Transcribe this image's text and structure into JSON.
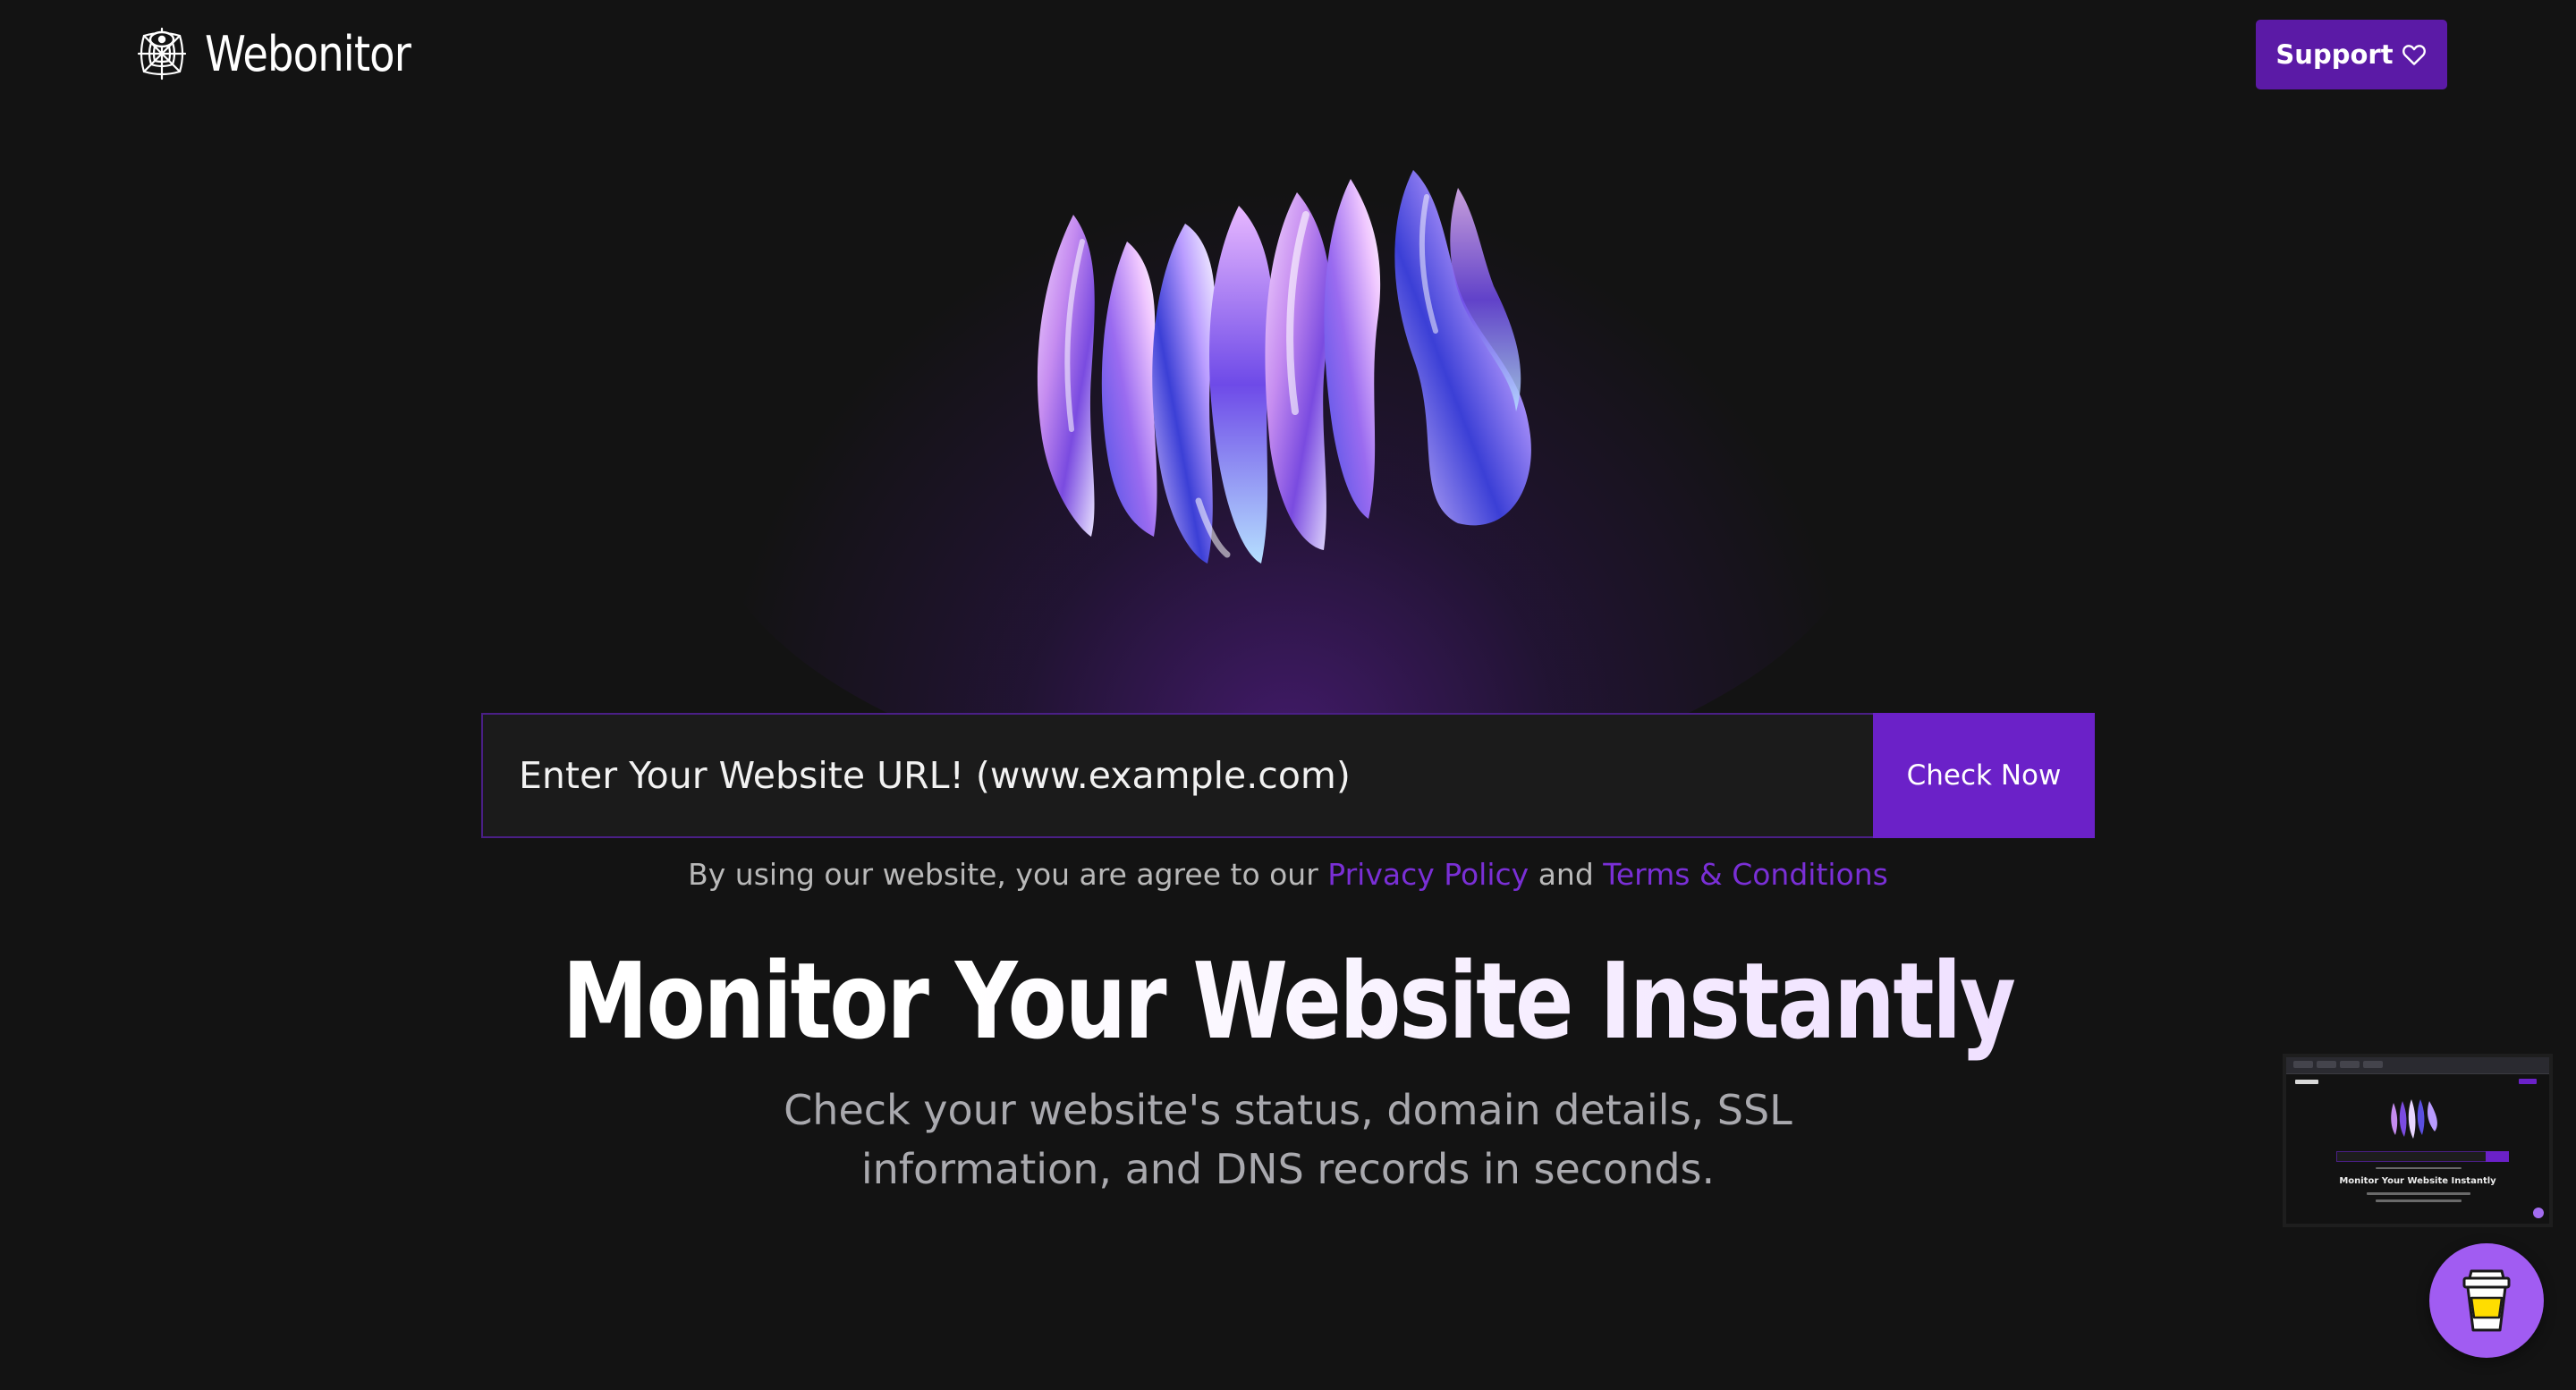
{
  "header": {
    "brand": "Webonitor",
    "support_label": "Support",
    "support_icon": "heart-icon"
  },
  "search": {
    "placeholder": "Enter Your Website URL! (www.example.com)",
    "button_label": "Check Now"
  },
  "consent": {
    "prefix": "By using our website, you are agree to our",
    "privacy_link": "Privacy Policy",
    "conjunction": "and",
    "terms_link": "Terms & Conditions"
  },
  "hero": {
    "title": "Monitor Your Website Instantly",
    "subtitle": "Check your website's status, domain details, SSL information, and DNS records in seconds."
  },
  "preview": {
    "title": "Monitor Your Website Instantly"
  },
  "widget": {
    "icon": "coffee-cup-icon"
  },
  "colors": {
    "background": "#131313",
    "accent": "#6b21c8",
    "support_button": "#5b1aa6",
    "link": "#7a2fd6",
    "coffee_button": "#a15cf2"
  }
}
